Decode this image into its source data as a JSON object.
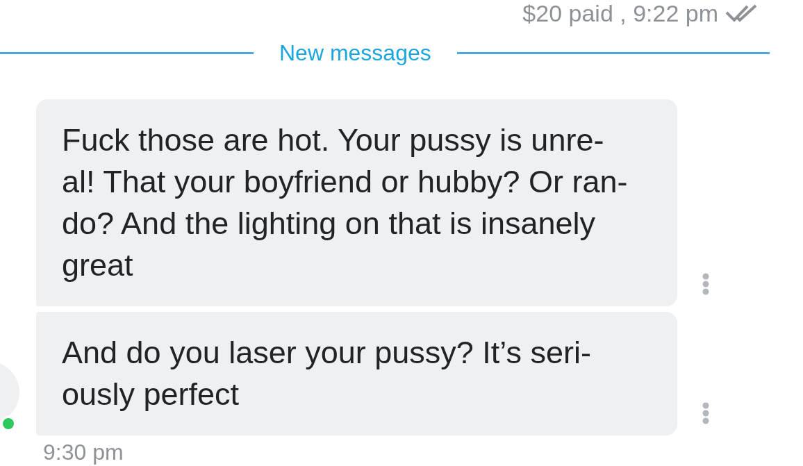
{
  "header": {
    "payment_status": "$20 paid , 9:22 pm",
    "read": true
  },
  "divider": {
    "label": "New messages"
  },
  "sender": {
    "online": true
  },
  "messages": [
    {
      "text": "Fuck those are hot. Your pussy is unre-\nal! That your boyfriend or hubby? Or ran-\ndo? And the lighting on that is insanely\ngreat"
    },
    {
      "text": "And do you laser your pussy? It’s seri-\nously perfect"
    }
  ],
  "footer": {
    "time": "9:30 pm"
  }
}
